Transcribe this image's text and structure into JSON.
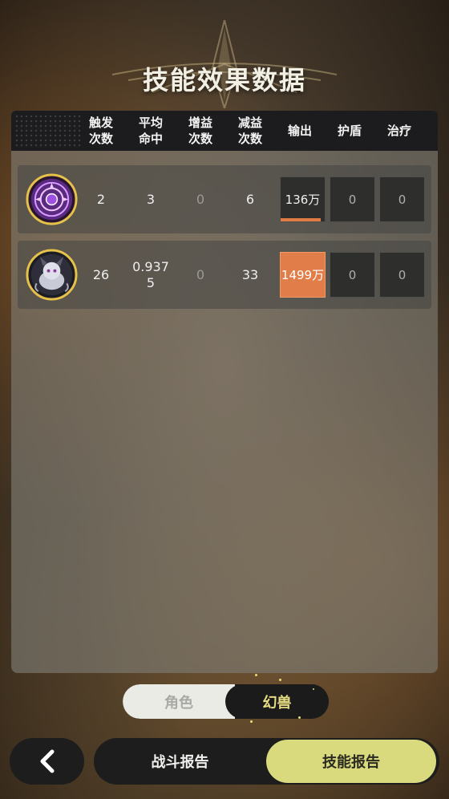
{
  "title": "技能效果数据",
  "table": {
    "headers": [
      "触发\n次数",
      "平均\n命中",
      "增益\n次数",
      "减益\n次数",
      "输出",
      "护盾",
      "治疗"
    ],
    "rows": [
      {
        "avatar_icon": "purple-magic-circle-icon",
        "trigger_count": "2",
        "avg_hits": "3",
        "buff_count": "0",
        "debuff_count": "6",
        "damage": "136万",
        "damage_fraction": 0.91,
        "shield": "0",
        "heal": "0"
      },
      {
        "avatar_icon": "gray-beast-character-icon",
        "trigger_count": "26",
        "avg_hits": "0.937\n5",
        "buff_count": "0",
        "debuff_count": "33",
        "damage": "1499万",
        "damage_fraction": 1.0,
        "shield": "0",
        "heal": "0"
      }
    ]
  },
  "toggle": {
    "left_label": "角色",
    "right_label": "幻兽",
    "selected": "幻兽"
  },
  "bottom_tabs": {
    "battle_report": "战斗报告",
    "skill_report": "技能报告",
    "selected": "技能报告"
  },
  "colors": {
    "accent": "#d9d97d",
    "damage": "#e07d48",
    "selected_toggle_text": "#e6dd83"
  }
}
